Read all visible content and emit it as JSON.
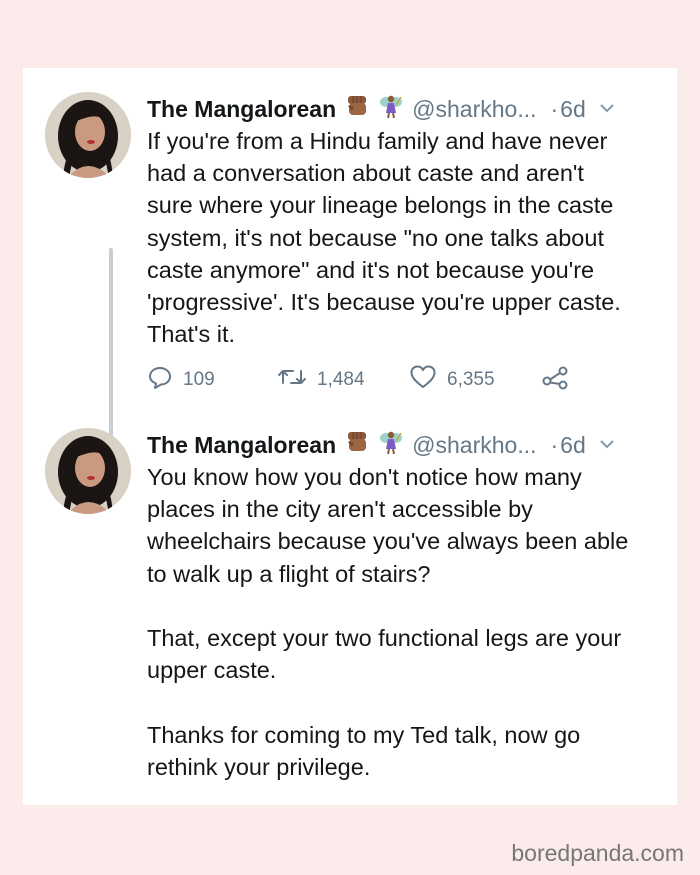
{
  "tweets": [
    {
      "author_name": "The Mangalorean",
      "handle": "@sharkho...",
      "time": "6d",
      "emoji": [
        "raised-fist-icon",
        "fairy-icon"
      ],
      "text": "If you're from a Hindu family and have never\nhad a conversation about caste and aren't\nsure where your lineage belongs in the caste\nsystem, it's not because \"no one talks about\ncaste anymore\" and it's not because you're\n'progressive'. It's because you're upper caste.\nThat's it.",
      "replies": "109",
      "retweets": "1,484",
      "likes": "6,355"
    },
    {
      "author_name": "The Mangalorean",
      "handle": "@sharkho...",
      "time": "6d",
      "emoji": [
        "raised-fist-icon",
        "fairy-icon"
      ],
      "text": "You know how you don't notice how many\nplaces in the city aren't accessible by\nwheelchairs because you've always been able\nto walk up a flight of stairs?\n\nThat, except your two functional legs are your\nupper caste.\n\nThanks for coming to my Ted talk, now go\nrethink your privilege."
    }
  ],
  "separator": "·",
  "watermark": "boredpanda.com",
  "colors": {
    "background": "#fcebeb",
    "card": "#ffffff",
    "text": "#14171a",
    "secondary": "#657786",
    "thread_line": "#c4cfd6"
  }
}
